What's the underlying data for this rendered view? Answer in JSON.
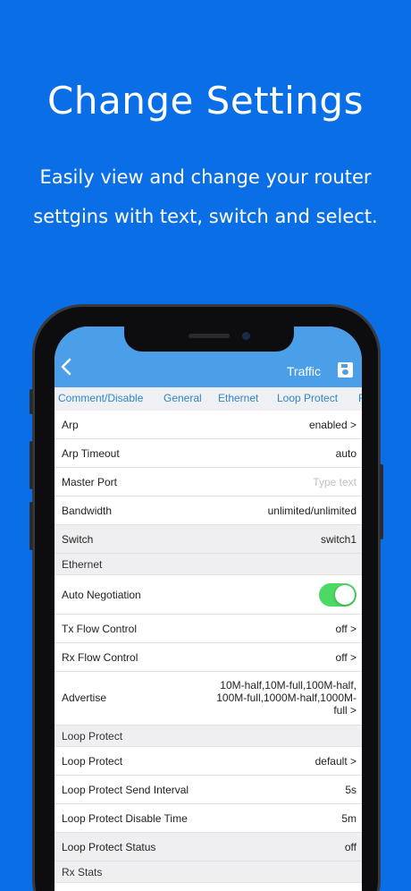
{
  "marketing": {
    "headline": "Change Settings",
    "sub_line1": "Easily view and change your router",
    "sub_line2": "settgins with text, switch and select."
  },
  "navbar": {
    "back_icon": "chevron-left-icon",
    "title": "Traffic",
    "save_icon": "save-icon"
  },
  "tabs": [
    "Comment/Disable",
    "General",
    "Ethernet",
    "Loop Protect",
    "R"
  ],
  "rows": {
    "arp": {
      "label": "Arp",
      "value": "enabled >"
    },
    "arp_timeout": {
      "label": "Arp Timeout",
      "value": "auto"
    },
    "master_port": {
      "label": "Master Port",
      "placeholder": "Type text"
    },
    "bandwidth": {
      "label": "Bandwidth",
      "value": "unlimited/unlimited"
    },
    "switch": {
      "label": "Switch",
      "value": "switch1"
    }
  },
  "ethernet": {
    "section": "Ethernet",
    "auto_negotiation": {
      "label": "Auto Negotiation",
      "on": true
    },
    "tx_flow": {
      "label": "Tx Flow Control",
      "value": "off >"
    },
    "rx_flow": {
      "label": "Rx Flow Control",
      "value": "off >"
    },
    "advertise": {
      "label": "Advertise",
      "line1": "10M-half,10M-full,100M-half,",
      "line2": "100M-full,1000M-half,1000M-",
      "line3": "full >"
    }
  },
  "loop_protect": {
    "section": "Loop Protect",
    "loop_protect": {
      "label": "Loop Protect",
      "value": "default >"
    },
    "send_interval": {
      "label": "Loop Protect Send Interval",
      "value": "5s"
    },
    "disable_time": {
      "label": "Loop Protect Disable Time",
      "value": "5m"
    },
    "status": {
      "label": "Loop Protect Status",
      "value": "off"
    }
  },
  "rx_stats": {
    "section": "Rx Stats"
  },
  "colors": {
    "background": "#0a6fe6",
    "navbar": "#4b9ee8",
    "tab_text": "#2f86c8",
    "toggle_on": "#4cd964"
  }
}
